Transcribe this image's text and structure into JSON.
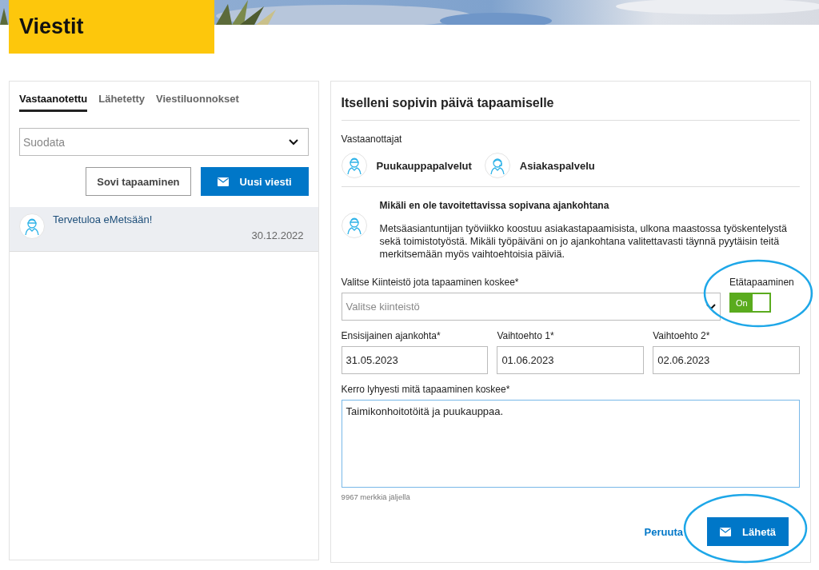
{
  "header": {
    "title": "Viestit"
  },
  "inbox": {
    "tabs": [
      {
        "label": "Vastaanotettu",
        "selected": true
      },
      {
        "label": "Lähetetty",
        "selected": false
      },
      {
        "label": "Viestiluonnokset",
        "selected": false
      }
    ],
    "filter": {
      "placeholder": "Suodata"
    },
    "buttons": [
      {
        "label": "Sovi tapaaminen",
        "kind": "secondary"
      },
      {
        "label": "Uusi viesti",
        "kind": "primary"
      }
    ],
    "messages": [
      {
        "title": "Tervetuloa eMetsään!",
        "date": "30.12.2022",
        "selected": true
      }
    ]
  },
  "form": {
    "title": "Itselleni sopivin päivä tapaamiselle",
    "recipients_label": "Vastaanottajat",
    "recipients": [
      {
        "name": "Puukauppapalvelut",
        "kind": "helmet"
      },
      {
        "name": "Asiakaspalvelu",
        "kind": "headset"
      }
    ],
    "notice": {
      "title": "Mikäli en ole tavoitettavissa sopivana ajankohtana",
      "text": "Metsäasiantuntijan työviikko koostuu asiakastapaamisista, ulkona maastossa työskentelystä sekä toimistotyöstä. Mikäli työpäiväni on jo ajankohtana valitettavasti täynnä pyytäisin teitä merkitsemään myös vaihtoehtoisia päiviä."
    },
    "property": {
      "label": "Valitse Kiinteistö jota tapaaminen koskee*",
      "placeholder": "Valitse kiinteistö"
    },
    "remote": {
      "label": "Etätapaaminen",
      "on": true,
      "state_label": "On"
    },
    "dates": [
      {
        "label": "Ensisijainen ajankohta*",
        "value": "31.05.2023"
      },
      {
        "label": "Vaihtoehto 1*",
        "value": "01.06.2023"
      },
      {
        "label": "Vaihtoehto 2*",
        "value": "02.06.2023"
      }
    ],
    "description": {
      "label": "Kerro lyhyesti mitä tapaaminen koskee*",
      "value": "Taimikonhoitotöitä ja puukauppaa."
    },
    "counter": "9967 merkkiä jäljellä",
    "actions": {
      "cancel": "Peruuta",
      "submit": "Lähetä"
    }
  }
}
